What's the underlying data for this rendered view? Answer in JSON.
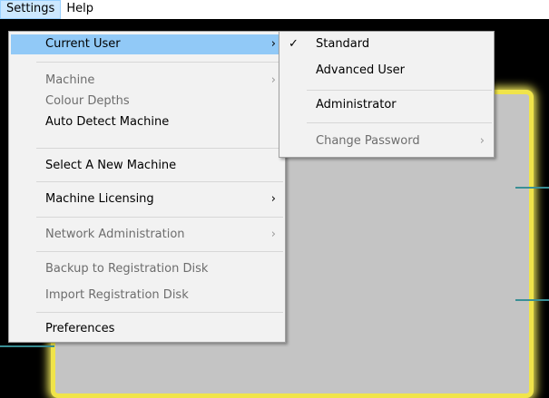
{
  "menubar": {
    "settings": "Settings",
    "help": "Help"
  },
  "settings_menu": {
    "current_user": "Current User",
    "machine": "Machine",
    "colour_depths": "Colour Depths",
    "auto_detect_machine": "Auto Detect Machine",
    "select_new_machine": "Select A New Machine",
    "machine_licensing": "Machine Licensing",
    "network_administration": "Network Administration",
    "backup_registration": "Backup to Registration Disk",
    "import_registration": "Import Registration Disk",
    "preferences": "Preferences",
    "submenu_arrow": "›"
  },
  "user_submenu": {
    "check_glyph": "✓",
    "standard": "Standard",
    "advanced_user": "Advanced User",
    "administrator": "Administrator",
    "change_password": "Change Password"
  },
  "colors": {
    "highlight": "#91c9f7",
    "canvas_border": "#f0e44a",
    "connector": "#3a8f95"
  }
}
